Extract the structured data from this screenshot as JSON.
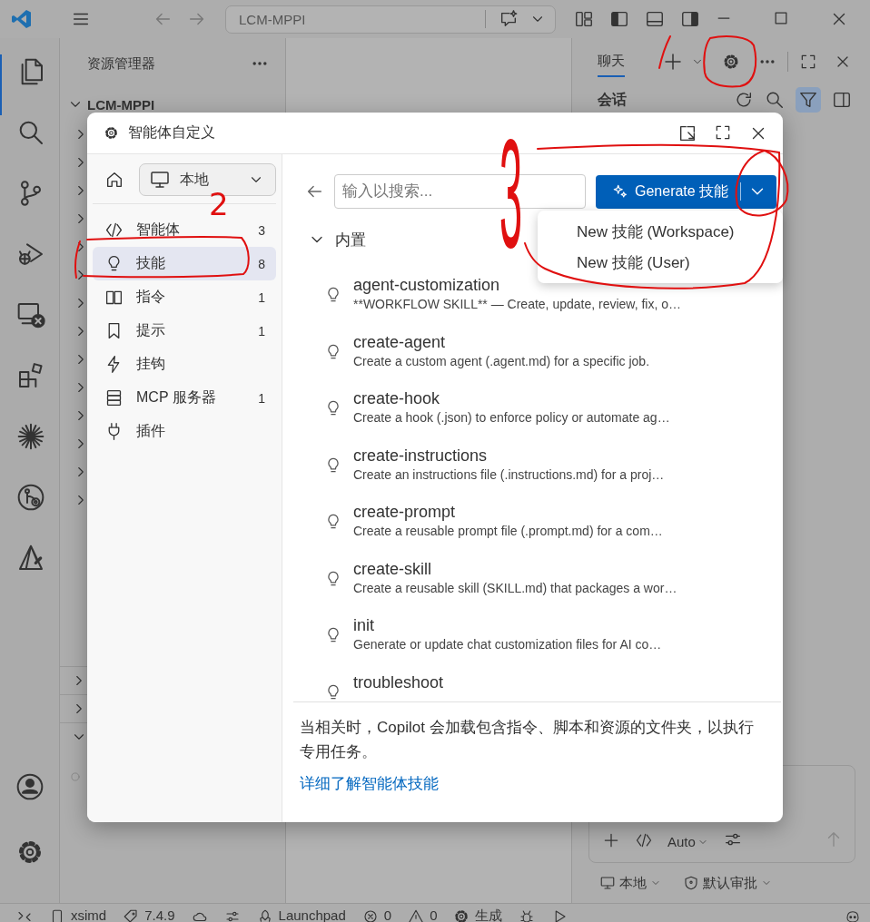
{
  "title_bar": {
    "command_center": "LCM-MPPI"
  },
  "activity_bar": [
    {
      "kind": "explorer",
      "selected": true
    },
    {
      "kind": "search",
      "selected": false
    },
    {
      "kind": "source-control",
      "selected": false
    },
    {
      "kind": "run-debug",
      "selected": false
    },
    {
      "kind": "remote",
      "selected": false
    },
    {
      "kind": "extensions",
      "selected": false
    },
    {
      "kind": "burst",
      "selected": false
    },
    {
      "kind": "git-graph",
      "selected": false
    },
    {
      "kind": "cmake",
      "selected": false
    }
  ],
  "explorer": {
    "title": "资源管理器",
    "root": "LCM-MPPI",
    "expanded": true,
    "folders": [
      {
        "expanded": false
      },
      {
        "expanded": false
      },
      {
        "expanded": false
      },
      {
        "expanded": false
      },
      {
        "expanded": false
      },
      {
        "expanded": false
      },
      {
        "expanded": false
      },
      {
        "expanded": false
      },
      {
        "expanded": false
      },
      {
        "expanded": false
      },
      {
        "expanded": false
      },
      {
        "expanded": false
      },
      {
        "expanded": false
      },
      {
        "expanded": false
      }
    ],
    "sections": [
      {
        "expanded": false
      },
      {
        "expanded": false
      },
      {
        "expanded": true
      }
    ]
  },
  "chat": {
    "tabs": [
      {
        "label": "聊天",
        "selected": true
      }
    ],
    "heading": "会话",
    "filter_on": true,
    "mode": "Auto",
    "options": [
      {
        "kind": "target",
        "label": "本地"
      },
      {
        "kind": "approval",
        "label": "默认审批"
      }
    ]
  },
  "dialog": {
    "title": "智能体自定义",
    "scope": "本地",
    "nav": [
      {
        "kind": "agent",
        "label": "智能体",
        "count": "3",
        "selected": false
      },
      {
        "kind": "skill",
        "label": "技能",
        "count": "8",
        "selected": true
      },
      {
        "kind": "instruction",
        "label": "指令",
        "count": "1",
        "selected": false
      },
      {
        "kind": "prompt",
        "label": "提示",
        "count": "1",
        "selected": false
      },
      {
        "kind": "hook",
        "label": "挂钩",
        "selected": false
      },
      {
        "kind": "mcp",
        "label": "MCP 服务器",
        "count": "1",
        "selected": false
      },
      {
        "kind": "plugin",
        "label": "插件",
        "selected": false
      }
    ],
    "search": {
      "placeholder": "输入以搜索..."
    },
    "generate_button": "Generate 技能",
    "menu": [
      "New 技能 (Workspace)",
      "New 技能 (User)"
    ],
    "group": {
      "label": "内置",
      "expanded": true,
      "items": [
        {
          "name": "agent-customization",
          "description": "**WORKFLOW SKILL** — Create, update, review, fix, o…"
        },
        {
          "name": "create-agent",
          "description": "Create a custom agent (.agent.md) for a specific job."
        },
        {
          "name": "create-hook",
          "description": "Create a hook (.json) to enforce policy or automate ag…"
        },
        {
          "name": "create-instructions",
          "description": "Create an instructions file (.instructions.md) for a proj…"
        },
        {
          "name": "create-prompt",
          "description": "Create a reusable prompt file (.prompt.md) for a com…"
        },
        {
          "name": "create-skill",
          "description": "Create a reusable skill (SKILL.md) that packages a wor…"
        },
        {
          "name": "init",
          "description": "Generate or update chat customization files for AI co…"
        },
        {
          "name": "troubleshoot"
        }
      ]
    },
    "footer": {
      "text": "当相关时，Copilot 会加载包含指令、脚本和资源的文件夹，以执行专用任务。",
      "link": "详细了解智能体技能"
    }
  },
  "status_bar": [
    {
      "kind": "remote"
    },
    {
      "kind": "workspace",
      "text": "xsimd"
    },
    {
      "kind": "tag",
      "text": "7.4.9"
    },
    {
      "kind": "cloud"
    },
    {
      "kind": "cmake"
    },
    {
      "kind": "launchpad",
      "text": "Launchpad"
    },
    {
      "kind": "errors",
      "text": "0"
    },
    {
      "kind": "warnings",
      "text": "0"
    },
    {
      "kind": "build",
      "text": "生成"
    },
    {
      "kind": "debug"
    },
    {
      "kind": "run"
    },
    {
      "kind": "copilot"
    }
  ],
  "annotations": [
    {
      "text": "2"
    },
    {
      "text": "3"
    }
  ]
}
